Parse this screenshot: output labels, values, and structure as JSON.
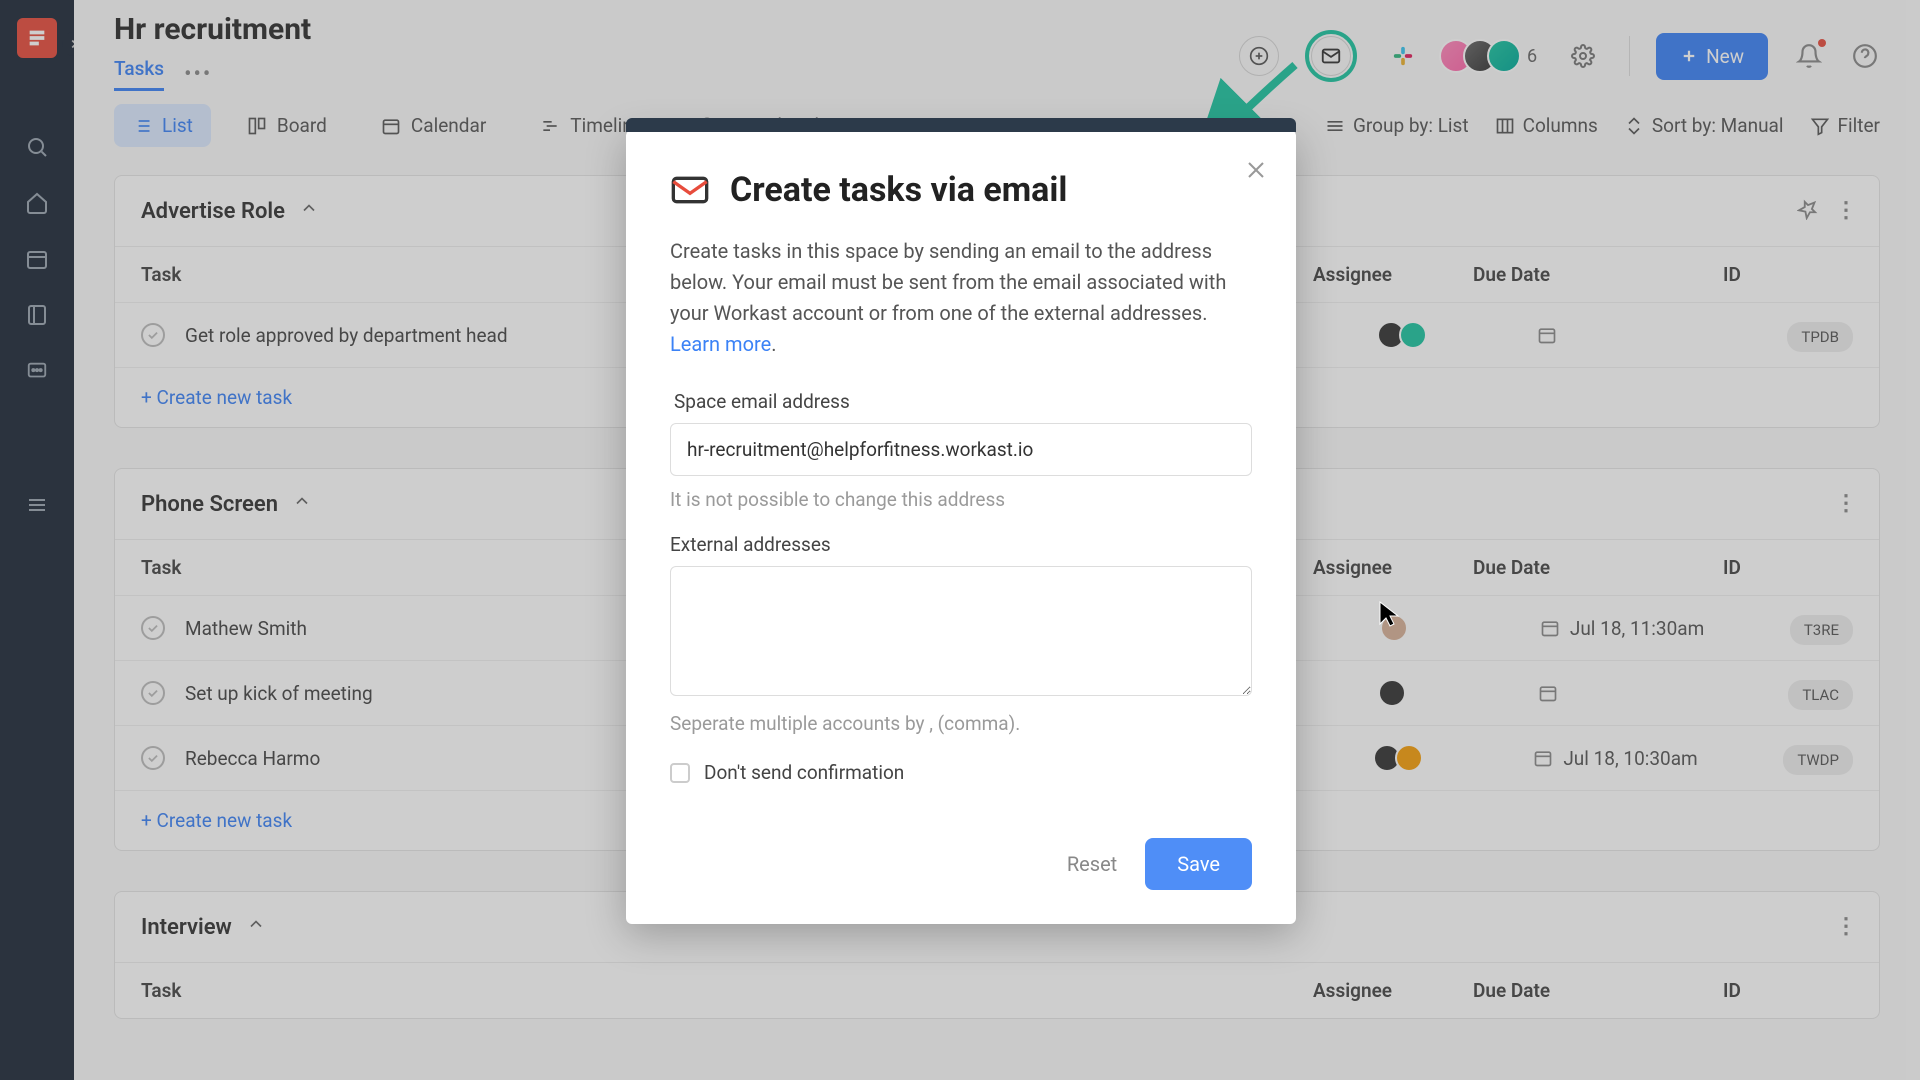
{
  "space": {
    "title": "Hr recruitment",
    "tabs": {
      "tasks": "Tasks"
    }
  },
  "topbar": {
    "member_count": "6",
    "new_button": "New"
  },
  "viewbar": {
    "list": "List",
    "board": "Board",
    "calendar": "Calendar",
    "timeline": "Timeline",
    "completed": "Completed",
    "group_by": "Group by: List",
    "columns": "Columns",
    "sort_by": "Sort by: Manual",
    "filter": "Filter"
  },
  "columns": {
    "task": "Task",
    "assignee": "Assignee",
    "due": "Due Date",
    "id": "ID"
  },
  "sections": [
    {
      "name": "Advertise Role",
      "tasks": [
        {
          "title": "Get role approved by department head",
          "due": "",
          "id": "TPDB",
          "assignees": [
            "a",
            "b"
          ]
        }
      ]
    },
    {
      "name": "Phone Screen",
      "tasks": [
        {
          "title": "Mathew Smith",
          "due": "Jul 18, 11:30am",
          "id": "T3RE",
          "assignees": [
            "a"
          ]
        },
        {
          "title": "Set up kick of meeting",
          "due": "",
          "id": "TLAC",
          "assignees": [
            "c"
          ]
        },
        {
          "title": "Rebecca Harmo",
          "due": "Jul 18, 10:30am",
          "id": "TWDP",
          "assignees": [
            "c",
            "d"
          ]
        }
      ]
    },
    {
      "name": "Interview",
      "tasks": []
    }
  ],
  "create_task": "+ Create new task",
  "modal": {
    "title": "Create tasks via email",
    "description": "Create tasks in this space by sending an email to the address below. Your email must be sent from the email associated with your Workast account or from one of the external addresses. ",
    "learn_more": "Learn more",
    "space_email_label": "Space email address",
    "space_email_value": "hr-recruitment@helpforfitness.workast.io",
    "space_email_hint": "It is not possible to change this address",
    "external_label": "External addresses",
    "external_hint": "Seperate multiple accounts by , (comma).",
    "dont_send": "Don't send confirmation",
    "reset": "Reset",
    "save": "Save"
  }
}
